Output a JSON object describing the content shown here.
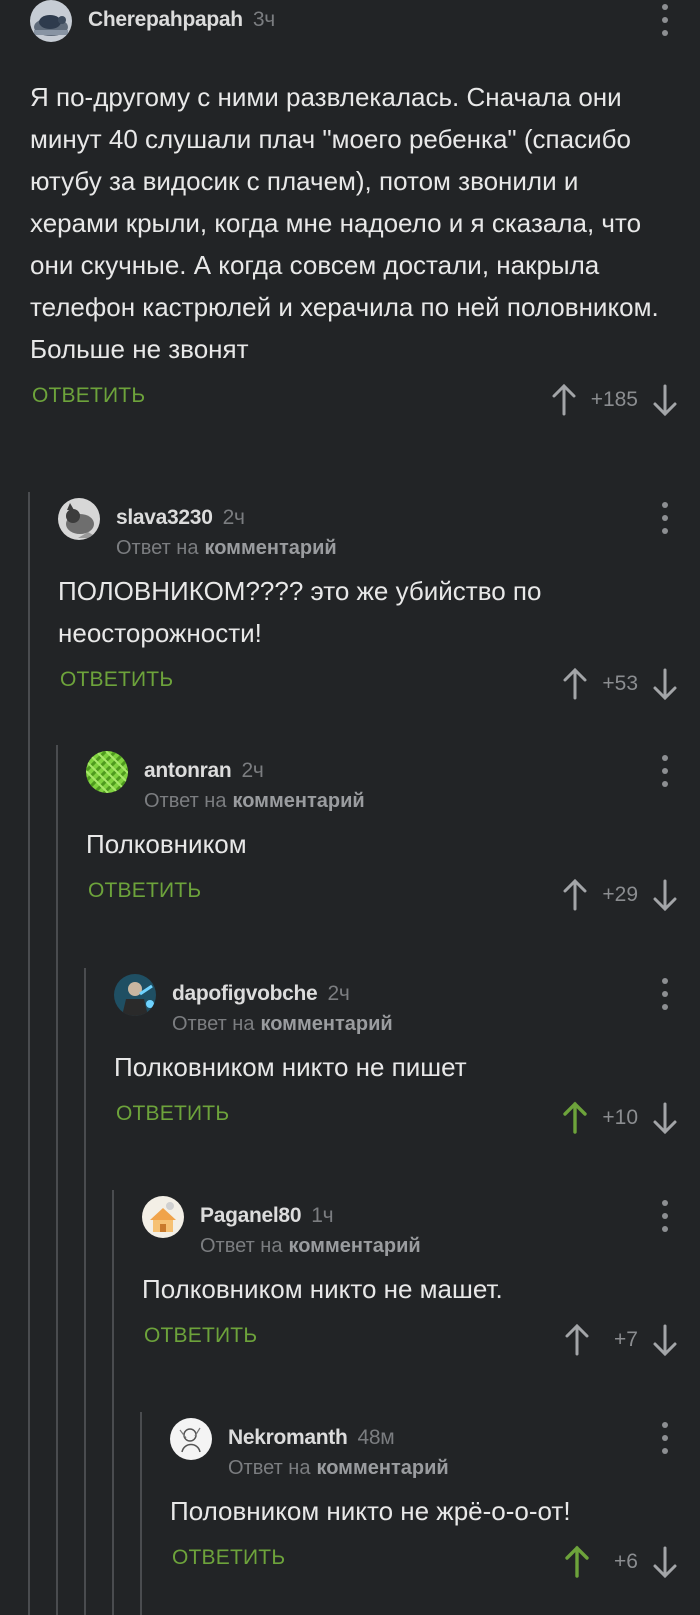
{
  "comments": [
    {
      "user": "Cherepahpapah",
      "time": "3ч",
      "reply_to_prefix": "",
      "reply_to_link": "",
      "text": "Я по-другому с ними развлекалась. Сначала они минут 40 слушали плач \"моего ребенка\" (спасибо ютубу за видосик с плачем), потом звонили и херами крыли, когда мне надоело и я сказала, что они скучные. А когда совсем достали, накрыла телефон кастрюлей и херачила по ней половником. Больше не звонят",
      "reply_label": "ОТВЕТИТЬ",
      "rating": "+185",
      "upvoted": false,
      "avatar": "turtle-avatar"
    },
    {
      "user": "slava3230",
      "time": "2ч",
      "reply_to_prefix": "Ответ на",
      "reply_to_link": "комментарий",
      "text": "ПОЛОВНИКОМ???? это же убийство по неосторожности!",
      "reply_label": "ОТВЕТИТЬ",
      "rating": "+53",
      "upvoted": false,
      "avatar": "cat-avatar"
    },
    {
      "user": "antonran",
      "time": "2ч",
      "reply_to_prefix": "Ответ на",
      "reply_to_link": "комментарий",
      "text": "Полковником",
      "reply_label": "ОТВЕТИТЬ",
      "rating": "+29",
      "upvoted": false,
      "avatar": "pattern-avatar"
    },
    {
      "user": "dapofigvobche",
      "time": "2ч",
      "reply_to_prefix": "Ответ на",
      "reply_to_link": "комментарий",
      "text": "Полковником никто не пишет",
      "reply_label": "ОТВЕТИТЬ",
      "rating": "+10",
      "upvoted": true,
      "avatar": "person-avatar"
    },
    {
      "user": "Paganel80",
      "time": "1ч",
      "reply_to_prefix": "Ответ на",
      "reply_to_link": "комментарий",
      "text": "Полковником никто не машет.",
      "reply_label": "ОТВЕТИТЬ",
      "rating": "+7",
      "upvoted": false,
      "avatar": "house-avatar"
    },
    {
      "user": "Nekromanth",
      "time": "48м",
      "reply_to_prefix": "Ответ на",
      "reply_to_link": "комментарий",
      "text": "Половником никто не жрё-о-о-от!",
      "reply_label": "ОТВЕТИТЬ",
      "rating": "+6",
      "upvoted": true,
      "avatar": "sketch-avatar"
    }
  ],
  "colors": {
    "background": "#222426",
    "accent_green": "#6da33b",
    "muted_text": "#7b7d80",
    "thread_line": "#4a4c4f"
  }
}
